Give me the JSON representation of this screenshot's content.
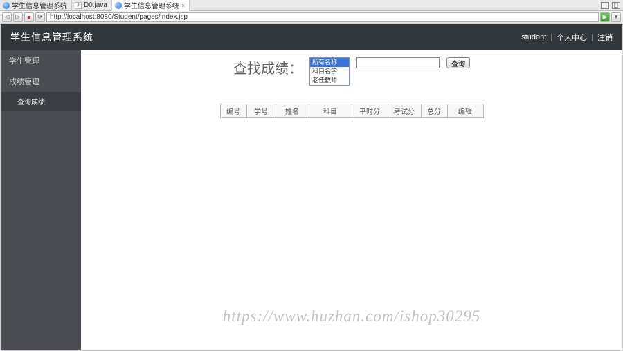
{
  "ide": {
    "tabs": [
      {
        "label": "学生信息管理系统",
        "kind": "browser"
      },
      {
        "label": "D0.java",
        "kind": "java"
      },
      {
        "label": "学生信息管理系统",
        "kind": "browser",
        "active": true
      }
    ]
  },
  "browser": {
    "url": "http://localhost:8080/Student/pages/index.jsp"
  },
  "header": {
    "title": "学生信息管理系统",
    "user": "student",
    "link_personal": "个人中心",
    "link_logout": "注销",
    "sep": "|"
  },
  "sidebar": {
    "items": [
      {
        "label": "学生管理"
      },
      {
        "label": "成绩管理"
      }
    ],
    "sub": {
      "label": "查询成绩"
    }
  },
  "search": {
    "label": "查找成绩：",
    "options": [
      "所有名称",
      "科目名字",
      "老任教师"
    ],
    "selected": 0,
    "input_value": "",
    "button": "查询"
  },
  "table": {
    "headers": [
      "编号",
      "学号",
      "姓名",
      "科目",
      "平时分",
      "考试分",
      "总分",
      "编辑"
    ],
    "widths": [
      38,
      42,
      48,
      62,
      52,
      48,
      38,
      52
    ]
  },
  "watermark": "https://www.huzhan.com/ishop30295"
}
